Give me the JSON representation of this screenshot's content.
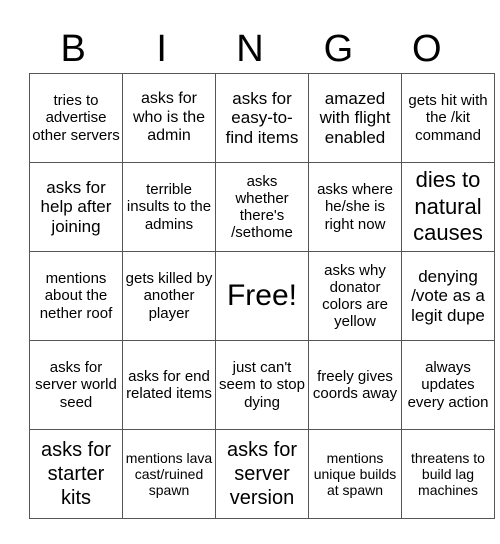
{
  "header": [
    "B",
    "I",
    "N",
    "G",
    "O"
  ],
  "rows": [
    [
      "tries to advertise other servers",
      "asks for who is the admin",
      "asks for easy-to-find items",
      "amazed with flight enabled",
      "gets hit with the /kit command"
    ],
    [
      "asks for help after joining",
      "terrible insults to the admins",
      "asks whether there's /sethome",
      "asks where he/she is right now",
      "dies to natural causes"
    ],
    [
      "mentions about the nether roof",
      "gets killed by another player",
      "Free!",
      "asks why donator colors are yellow",
      "denying /vote as a legit dupe"
    ],
    [
      "asks for server world seed",
      "asks for end related items",
      "just can't seem to stop dying",
      "freely gives coords away",
      "always updates every action"
    ],
    [
      "asks for starter kits",
      "mentions lava cast/ruined spawn",
      "asks for server version",
      "mentions unique builds at spawn",
      "threatens to build lag machines"
    ]
  ]
}
